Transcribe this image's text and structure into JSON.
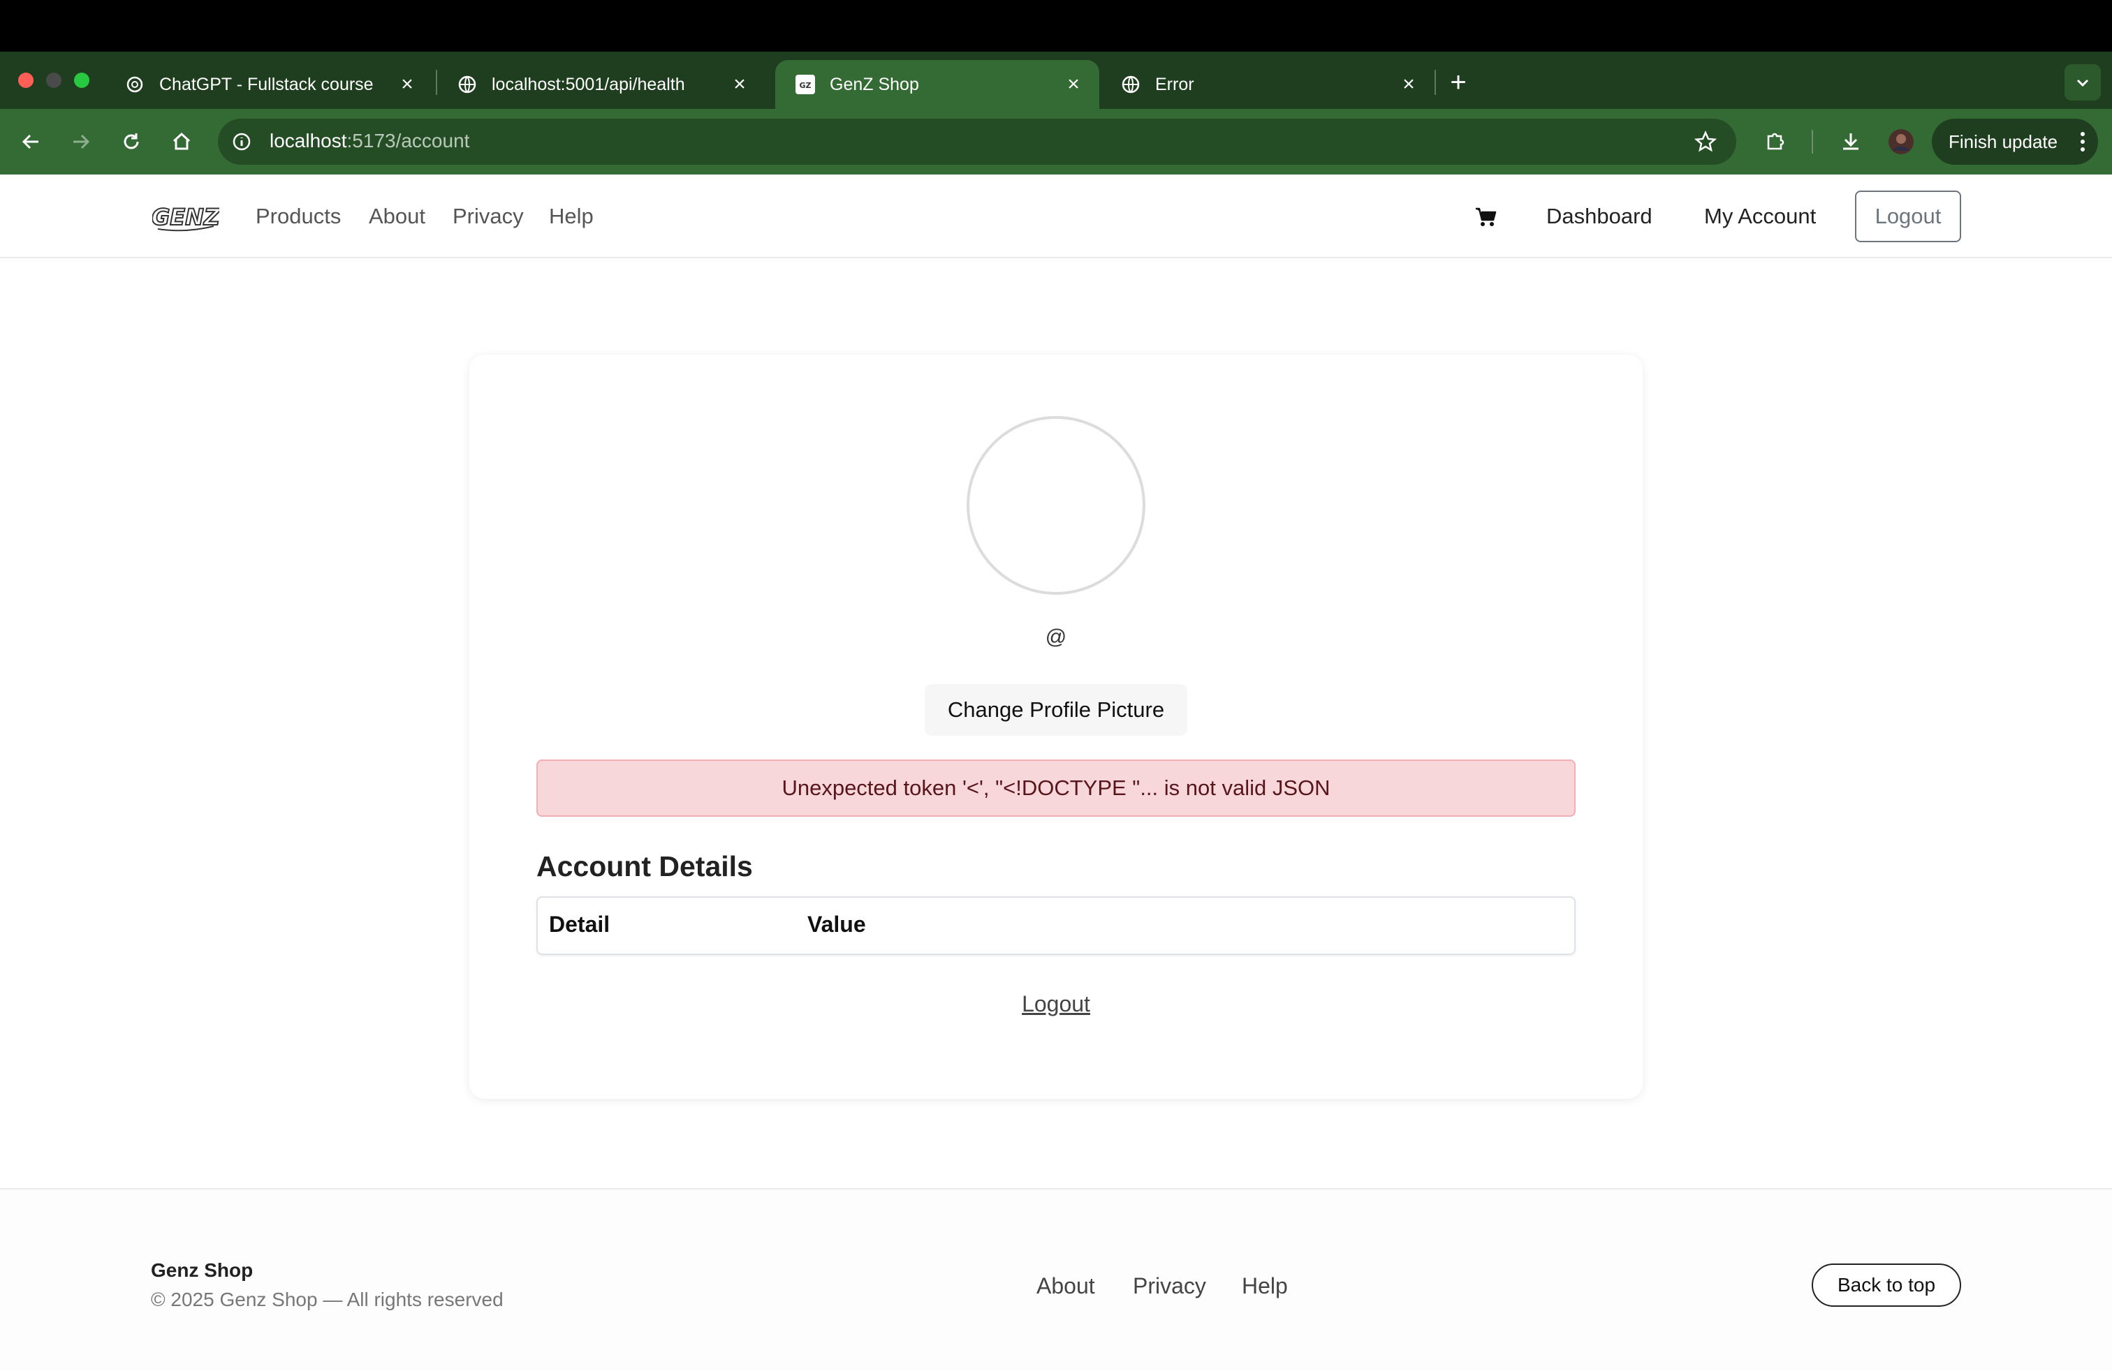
{
  "browser": {
    "tabs": [
      {
        "title": "ChatGPT - Fullstack course",
        "icon": "chatgpt-icon"
      },
      {
        "title": "localhost:5001/api/health",
        "icon": "globe-icon"
      },
      {
        "title": "GenZ Shop",
        "icon": "genz-favicon",
        "active": true
      },
      {
        "title": "Error",
        "icon": "globe-icon"
      }
    ],
    "new_tab": "+",
    "url_host": "localhost",
    "url_path": ":5173/account",
    "finish_update": "Finish update"
  },
  "nav": {
    "logo": "GENZ",
    "links": [
      "Products",
      "About",
      "Privacy",
      "Help"
    ],
    "dashboard": "Dashboard",
    "my_account": "My Account",
    "logout": "Logout"
  },
  "account": {
    "handle": "@",
    "change_picture": "Change Profile Picture",
    "error": "Unexpected token '<', \"<!DOCTYPE \"... is not valid JSON",
    "details_title": "Account Details",
    "table_headers": [
      "Detail",
      "Value"
    ],
    "logout_link": "Logout"
  },
  "footer": {
    "brand": "Genz Shop",
    "copyright": "© 2025 Genz Shop — All rights reserved",
    "links": [
      "About",
      "Privacy",
      "Help"
    ],
    "back_to_top": "Back to top"
  }
}
